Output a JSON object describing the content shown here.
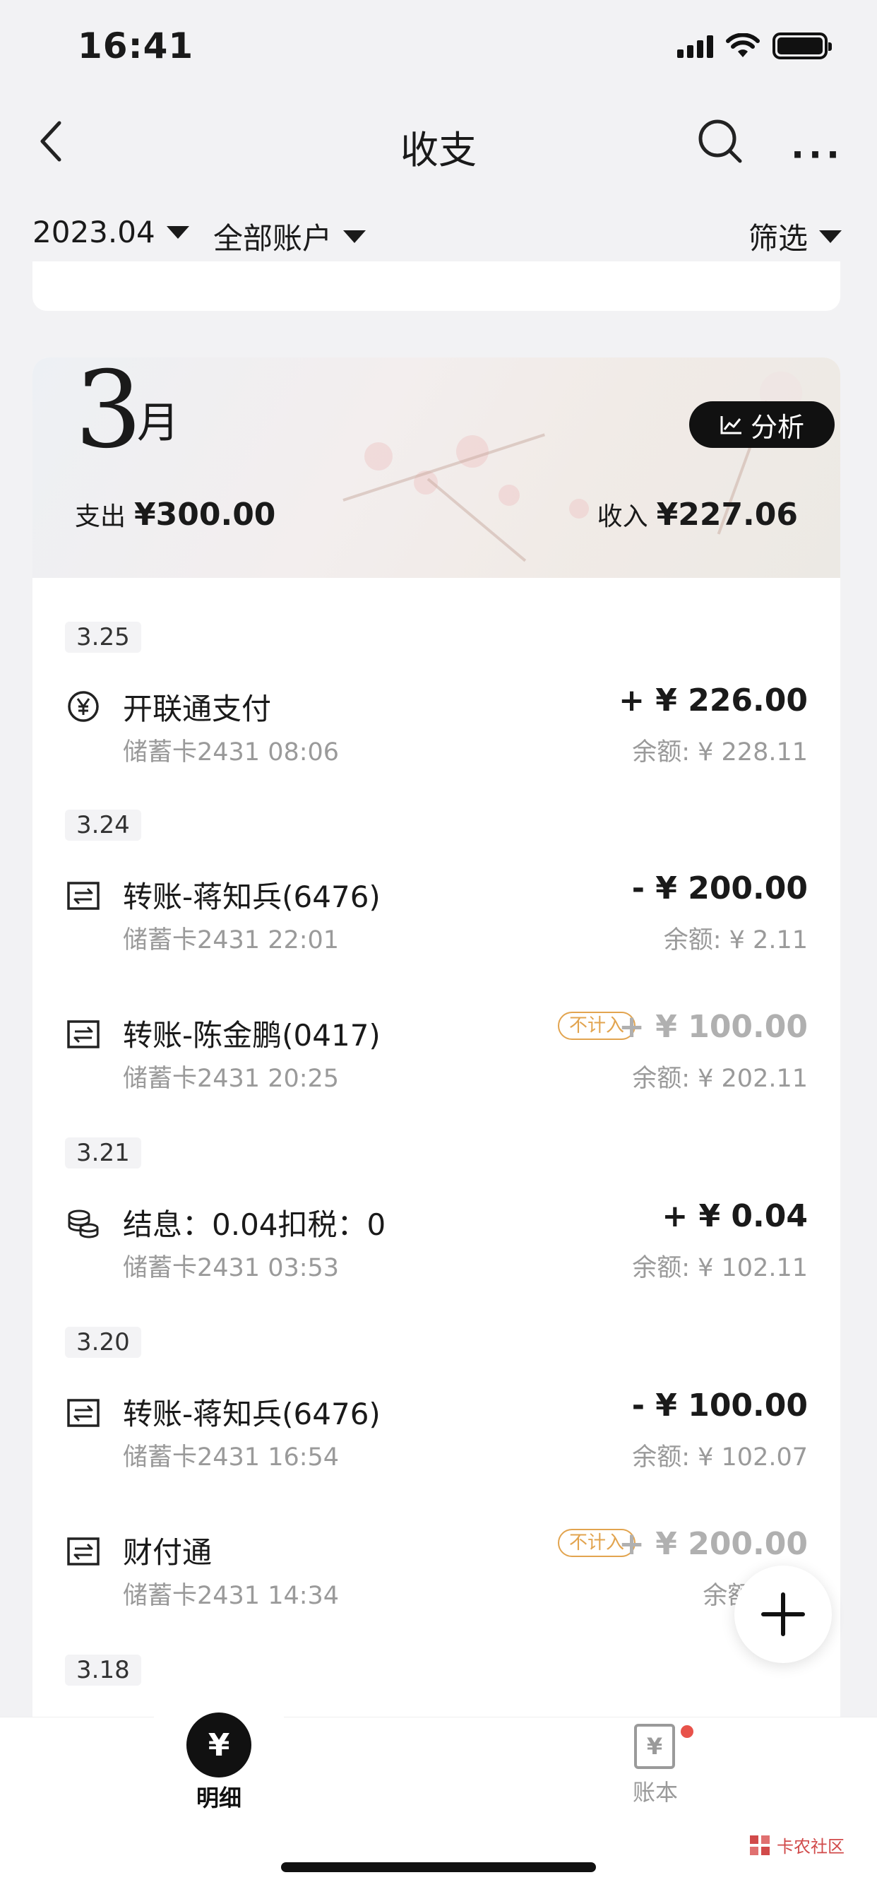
{
  "status_bar": {
    "time": "16:41"
  },
  "nav": {
    "title": "收支"
  },
  "filters": {
    "month": "2023.04",
    "accounts": "全部账户",
    "filter": "筛选"
  },
  "month_card": {
    "month_number": "3",
    "month_unit": "月",
    "analysis_label": "分析",
    "expense_label": "支出",
    "expense_amount": "¥300.00",
    "income_label": "收入",
    "income_amount": "¥227.06"
  },
  "groups": [
    {
      "date": "3.25",
      "transactions": [
        {
          "icon": "yuan-circle-icon",
          "title": "开联通支付",
          "subtitle": "储蓄卡2431 08:06",
          "amount": "+ ¥ 226.00",
          "balance": "余额: ¥ 228.11",
          "excluded": false
        }
      ]
    },
    {
      "date": "3.24",
      "transactions": [
        {
          "icon": "transfer-icon",
          "title": "转账-蒋知兵(6476)",
          "subtitle": "储蓄卡2431 22:01",
          "amount": "- ¥ 200.00",
          "balance": "余额: ¥ 2.11",
          "excluded": false
        },
        {
          "icon": "transfer-icon",
          "title": "转账-陈金鹏(0417)",
          "subtitle": "储蓄卡2431 20:25",
          "amount": "+ ¥ 100.00",
          "balance": "余额: ¥ 202.11",
          "excluded": true,
          "badge": "不计入"
        }
      ]
    },
    {
      "date": "3.21",
      "transactions": [
        {
          "icon": "coins-icon",
          "title": "结息：0.04扣税：0",
          "subtitle": "储蓄卡2431 03:53",
          "amount": "+ ¥ 0.04",
          "balance": "余额: ¥ 102.11",
          "excluded": false
        }
      ]
    },
    {
      "date": "3.20",
      "transactions": [
        {
          "icon": "transfer-icon",
          "title": "转账-蒋知兵(6476)",
          "subtitle": "储蓄卡2431 16:54",
          "amount": "- ¥ 100.00",
          "balance": "余额: ¥ 102.07",
          "excluded": false
        },
        {
          "icon": "transfer-icon",
          "title": "财付通",
          "subtitle": "储蓄卡2431 14:34",
          "amount": "+ ¥ 200.00",
          "balance": "余额: ¥ 2",
          "excluded": true,
          "badge": "不计入"
        }
      ]
    },
    {
      "date": "3.18",
      "transactions": []
    }
  ],
  "tabbar": {
    "detail_label": "明细",
    "detail_glyph": "¥",
    "ledger_label": "账本",
    "ledger_glyph": "¥"
  },
  "watermark": "卡农社区"
}
